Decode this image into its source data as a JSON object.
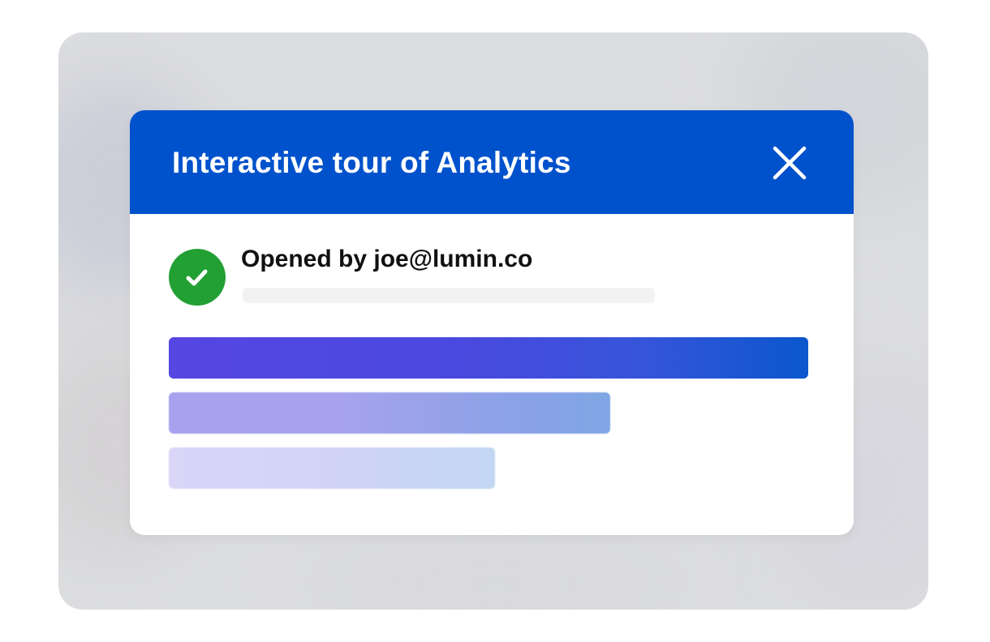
{
  "dialog": {
    "title": "Interactive tour of Analytics",
    "close_icon": "close-icon",
    "header_color": "#0052cc"
  },
  "status": {
    "icon": "check-circle-icon",
    "icon_color": "#22a034",
    "text": "Opened by joe@lumin.co"
  },
  "bars": [
    {
      "name": "progress-bar-primary",
      "level": 1.0,
      "color": "#4a49df"
    },
    {
      "name": "progress-bar-secondary",
      "level": 0.69,
      "color": "#a6a3ec"
    },
    {
      "name": "progress-bar-tertiary",
      "level": 0.51,
      "color": "#d0d3f5"
    }
  ]
}
